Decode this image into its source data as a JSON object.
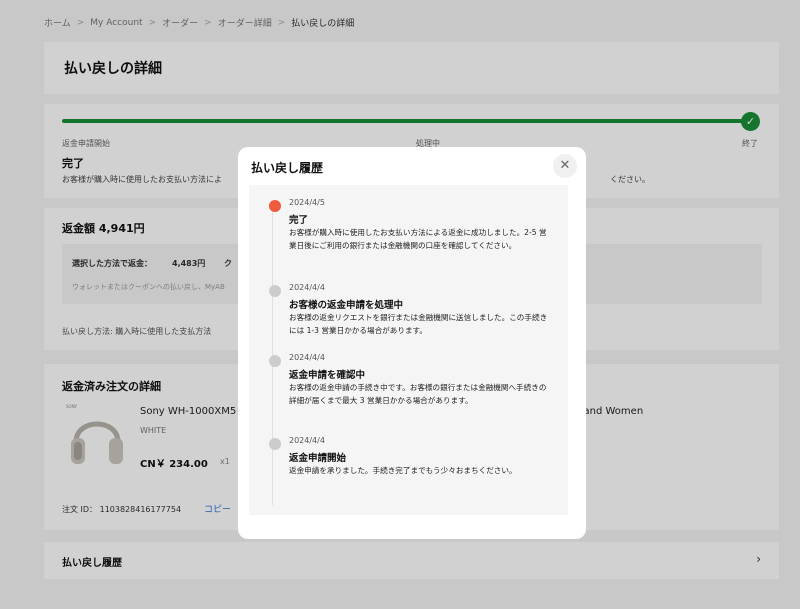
{
  "breadcrumb": [
    "ホーム",
    "My Account",
    "オーダー",
    "オーダー詳細",
    "払い戻しの詳細"
  ],
  "page_title": "払い戻しの詳細",
  "progress": {
    "steps": [
      "返金申請開始",
      "処理中",
      "終了"
    ],
    "status": "完了",
    "description": "お客様が購入時に使用したお支払い方法によ",
    "description_tail": "ください。",
    "percent": 100
  },
  "refund": {
    "amount_label": "返金額 4,941円",
    "selected_method_label": "選択した方法で返金：",
    "selected_method_value": "4,483円",
    "coupon_label": "ク",
    "note": "ウォレットまたはクーポンへの払い戻し、MyAB",
    "method": "払い戻し方法: 購入時に使用した支払方法"
  },
  "order": {
    "title": "返金済み注文の詳細",
    "product_name": "Sony WH-1000XM5 I",
    "product_name_tail": "n and Women",
    "brand": "SONY",
    "color": "WHITE",
    "price": "CN￥ 234.00",
    "qty": "x1",
    "order_id": "注文 ID： 1103828416177754",
    "copy_label": "コピー"
  },
  "history_section": {
    "title": "払い戻し履歴",
    "chevron": "›"
  },
  "modal": {
    "title": "払い戻し履歴",
    "close": "✕",
    "timeline": [
      {
        "date": "2024/4/5",
        "heading": "完了",
        "text": "お客様が購入時に使用したお支払い方法による返金に成功しました。2-5 営業日後にご利用の銀行または金融機関の口座を確認してください。",
        "active": true
      },
      {
        "date": "2024/4/4",
        "heading": "お客様の返金申請を処理中",
        "text": "お客様の返金リクエストを銀行または金融機関に送信しました。この手続きには 1-3 営業日かかる場合があります。",
        "active": false
      },
      {
        "date": "2024/4/4",
        "heading": "返金申請を確認中",
        "text": "お客様の返金申請の手続き中です。お客様の銀行または金融機関へ手続きの詳細が届くまで最大 3 営業日かかる場合があります。",
        "active": false
      },
      {
        "date": "2024/4/4",
        "heading": "返金申請開始",
        "text": "返金申請を承りました。手続き完了までもう少々おまちください。",
        "active": false
      }
    ]
  },
  "colors": {
    "progress": "#1a8f3a",
    "active_dot": "#f05a3c",
    "inactive_dot": "#cccccc",
    "link": "#2a6fd6"
  }
}
